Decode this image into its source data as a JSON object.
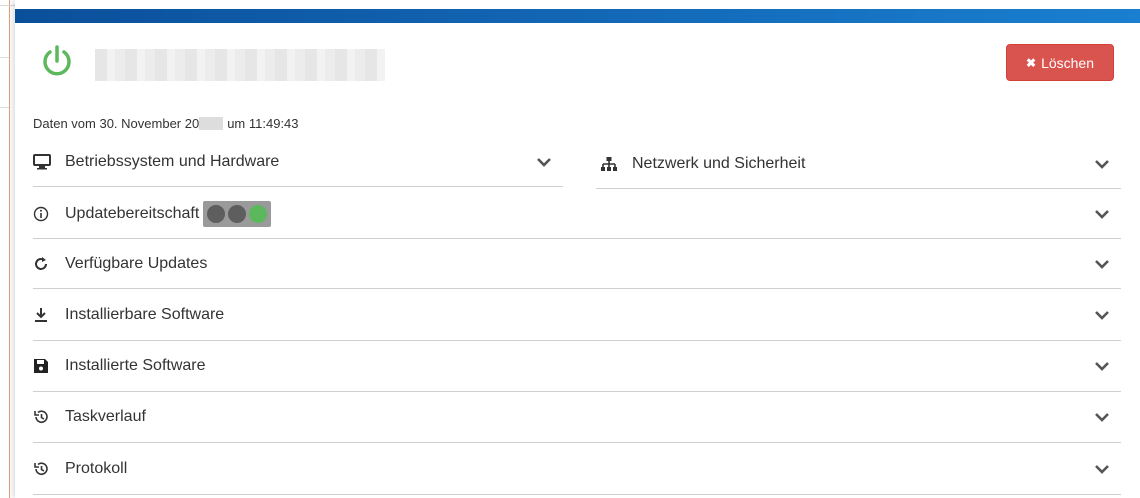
{
  "modal": {
    "delete_label": "Löschen",
    "timestamp_prefix": "Daten vom 30. November 20",
    "timestamp_suffix": "um 11:49:43"
  },
  "sections": {
    "os": {
      "label": "Betriebssystem und Hardware",
      "icon": "monitor-icon"
    },
    "network": {
      "label": "Netzwerk und Sicherheit",
      "icon": "sitemap-icon"
    },
    "readiness": {
      "label": "Updatebereitschaft",
      "icon": "info-icon",
      "lights": [
        "gray",
        "gray",
        "green"
      ]
    },
    "updates": {
      "label": "Verfügbare Updates",
      "icon": "refresh-icon"
    },
    "installable": {
      "label": "Installierbare Software",
      "icon": "download-icon"
    },
    "installed": {
      "label": "Installierte Software",
      "icon": "save-icon"
    },
    "tasks": {
      "label": "Taskverlauf",
      "icon": "history-icon"
    },
    "log": {
      "label": "Protokoll",
      "icon": "history-icon"
    }
  },
  "colors": {
    "accent": "#1a7fd0",
    "danger": "#d9534f",
    "success": "#5cb85c"
  }
}
